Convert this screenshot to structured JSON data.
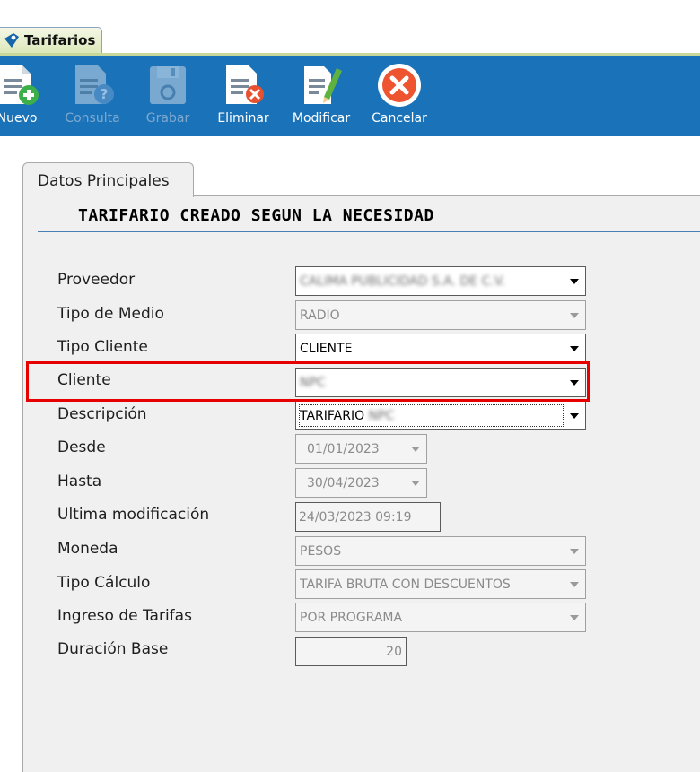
{
  "window": {
    "tab_label": "Tarifarios"
  },
  "toolbar": {
    "buttons": [
      {
        "label": "Nuevo",
        "icon": "document-add-icon",
        "enabled": true
      },
      {
        "label": "Consulta",
        "icon": "document-query-icon",
        "enabled": false
      },
      {
        "label": "Grabar",
        "icon": "save-disk-icon",
        "enabled": false
      },
      {
        "label": "Eliminar",
        "icon": "document-delete-icon",
        "enabled": true
      },
      {
        "label": "Modificar",
        "icon": "document-edit-icon",
        "enabled": true
      },
      {
        "label": "Cancelar",
        "icon": "cancel-circle-icon",
        "enabled": true
      }
    ]
  },
  "section": {
    "tab_label": "Datos Principales",
    "heading": "TARIFARIO CREADO SEGUN LA NECESIDAD"
  },
  "form": {
    "proveedor": {
      "label": "Proveedor",
      "value": "CALIMA PUBLICIDAD S.A. DE C.V."
    },
    "tipo_medio": {
      "label": "Tipo de Medio",
      "value": "RADIO"
    },
    "tipo_cliente": {
      "label": "Tipo Cliente",
      "value": "CLIENTE"
    },
    "cliente": {
      "label": "Cliente",
      "value": "NPC"
    },
    "descripcion": {
      "label": "Descripción",
      "value_prefix": "TARIFARIO",
      "value_blurred": "NPC"
    },
    "desde": {
      "label": "Desde",
      "value": "01/01/2023"
    },
    "hasta": {
      "label": "Hasta",
      "value": "30/04/2023"
    },
    "ultima_modificacion": {
      "label": "Ultima modificación",
      "value": "24/03/2023  09:19"
    },
    "moneda": {
      "label": "Moneda",
      "value": "PESOS"
    },
    "tipo_calculo": {
      "label": "Tipo Cálculo",
      "value": "TARIFA BRUTA CON DESCUENTOS"
    },
    "ingreso_tarifas": {
      "label": "Ingreso de Tarifas",
      "value": "POR PROGRAMA"
    },
    "duracion_base": {
      "label": "Duración Base",
      "value": "20"
    }
  },
  "colors": {
    "toolbar_bg": "#1a73b8",
    "panel_bg": "#f0f0f0",
    "highlight": "#e60000",
    "tab_bg": "#dce8b9"
  }
}
